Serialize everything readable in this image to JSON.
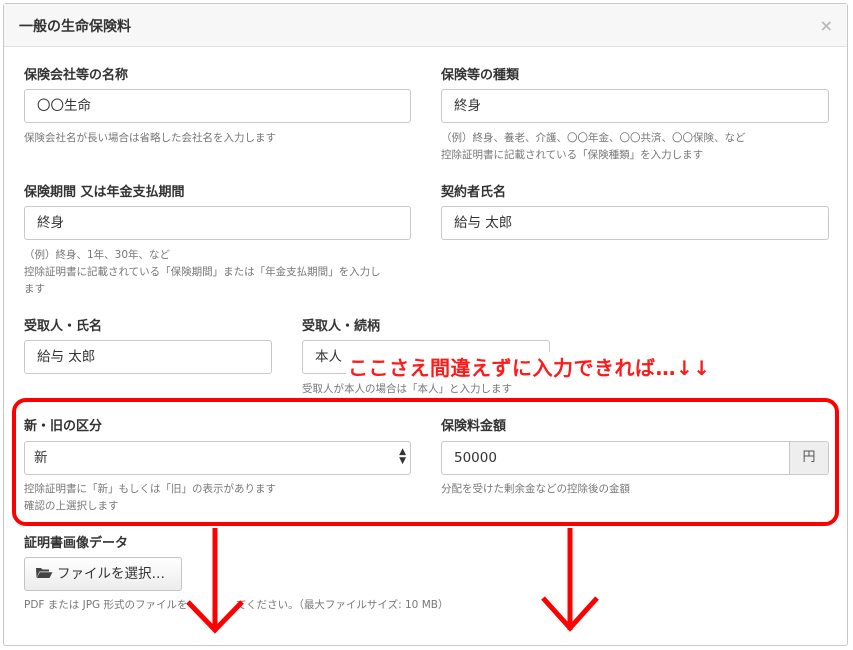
{
  "modal": {
    "title": "一般の生命保険料",
    "close_glyph": "×"
  },
  "company": {
    "label": "保険会社等の名称",
    "value": "〇〇生命",
    "help": "保険会社名が長い場合は省略した会社名を入力します"
  },
  "insurance_type": {
    "label": "保険等の種類",
    "value": "終身",
    "help_line1": "（例）終身、養老、介護、〇〇年金、〇〇共済、〇〇保険、など",
    "help_line2": "控除証明書に記載されている「保険種類」を入力します"
  },
  "period": {
    "label": "保険期間 又は年金支払期間",
    "value": "終身",
    "help_line1": "（例）終身、1年、30年、など",
    "help_line2": "控除証明書に記載されている「保険期間」または「年金支払期間」を入力し",
    "help_line3": "ます"
  },
  "contractor": {
    "label": "契約者氏名",
    "value": "給与 太郎"
  },
  "beneficiary": {
    "label": "受取人・氏名",
    "value": "給与 太郎"
  },
  "relationship": {
    "label": "受取人・続柄",
    "value": "本人",
    "help": "受取人が本人の場合は「本人」と入力します"
  },
  "category": {
    "label": "新・旧の区分",
    "selected": "新",
    "help_line1": "控除証明書に「新」もしくは「旧」の表示があります",
    "help_line2": "確認の上選択します"
  },
  "premium": {
    "label": "保険料金額",
    "value": "50000",
    "unit": "円",
    "help": "分配を受けた剰余金などの控除後の金額"
  },
  "certificate": {
    "label": "証明書画像データ",
    "button": "ファイルを選択…",
    "help_before": "PDF または JPG 形式のファイルを",
    "help_after": "てください。（最大ファイルサイズ: 10 MB）"
  },
  "annotation": {
    "text": "ここさえ間違えずに入力できれば…↓↓",
    "color": "#ff0000"
  },
  "icons": {
    "folder": "folder-open-icon",
    "select": "select-arrows-icon"
  }
}
